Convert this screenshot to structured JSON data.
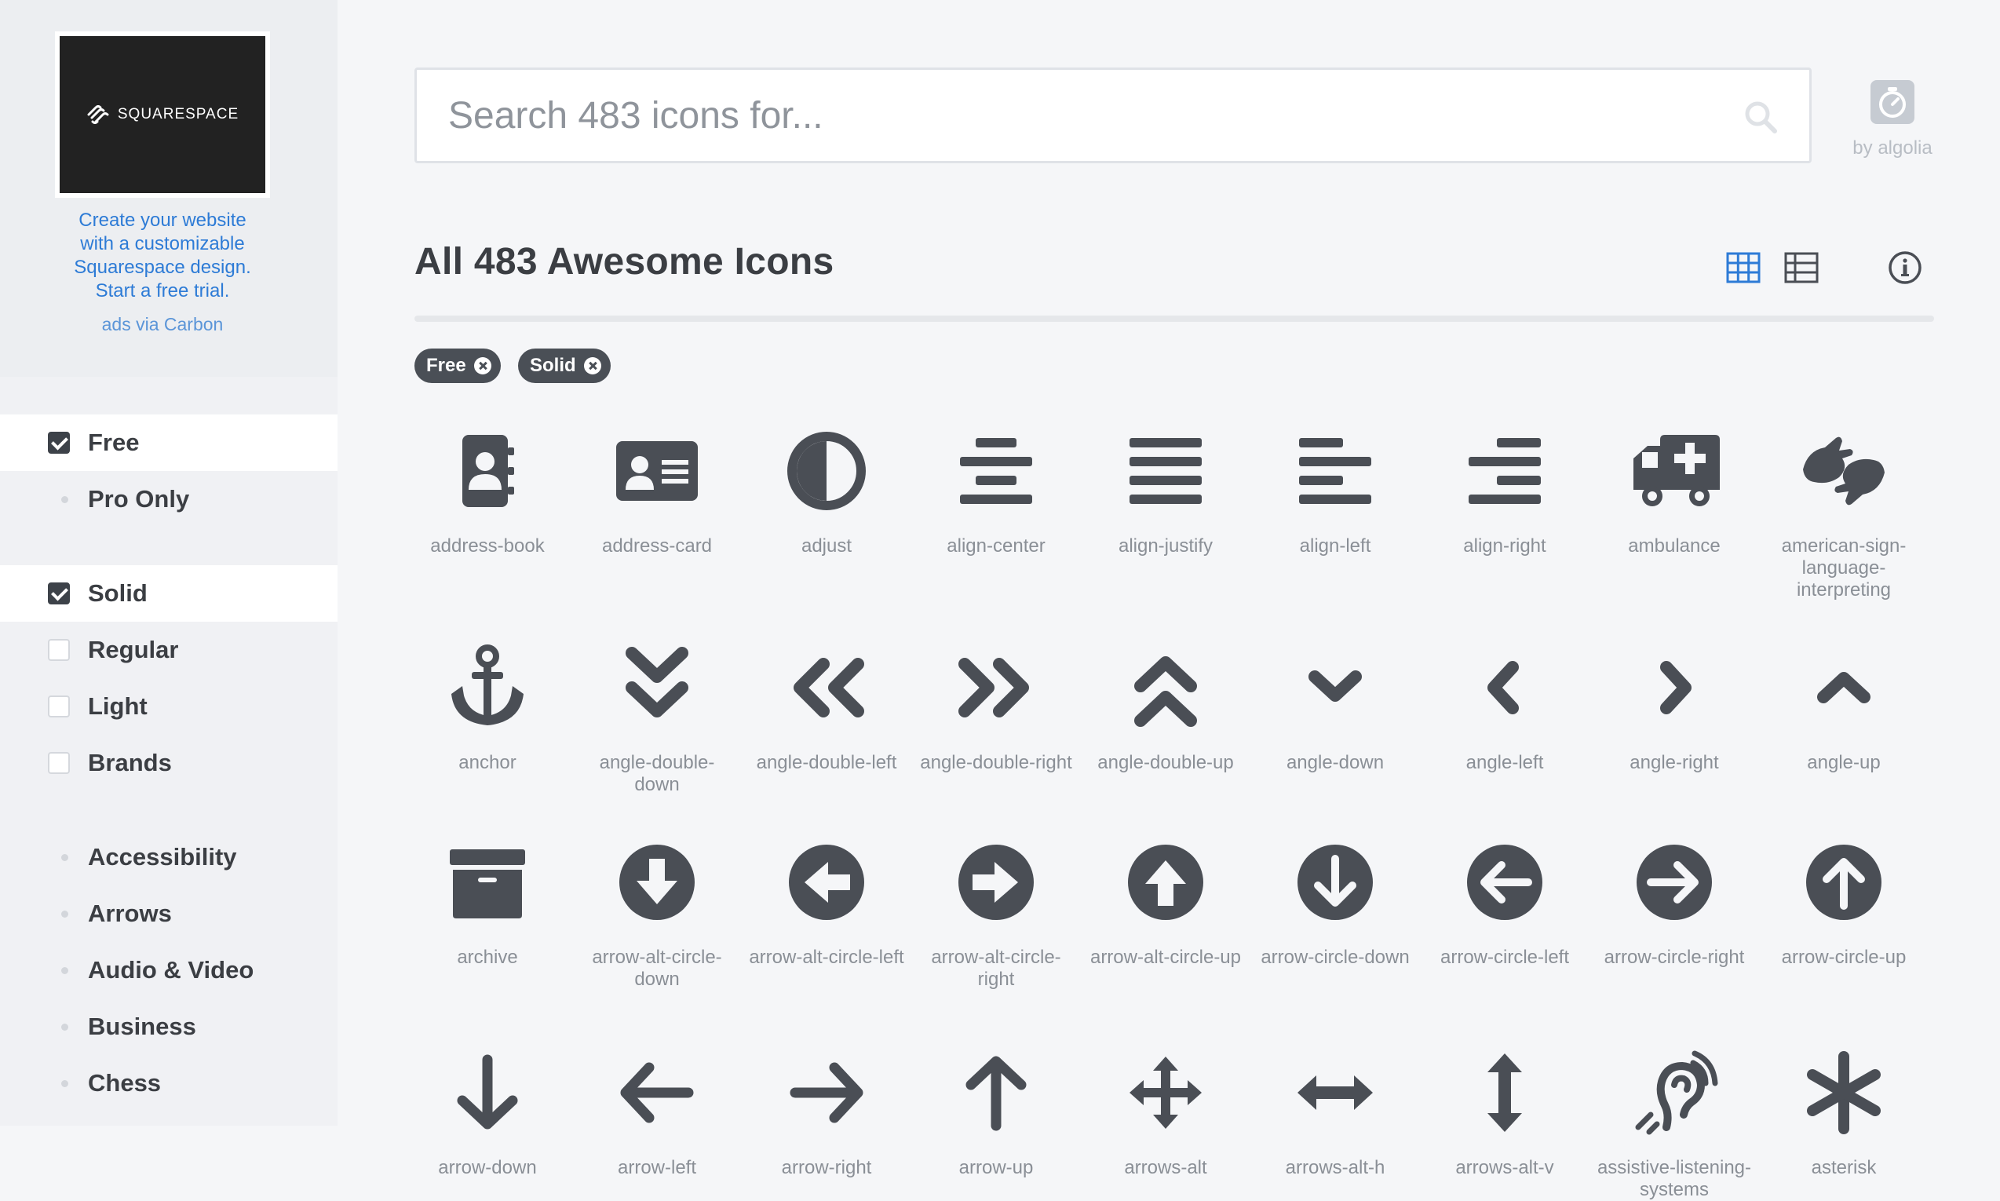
{
  "ad": {
    "brand": "SQUARESPACE",
    "line1": "Create your website",
    "line2": "with a customizable",
    "line3": "Squarespace design.",
    "line4": "Start a free trial.",
    "via": "ads via Carbon"
  },
  "filters": {
    "license": [
      {
        "label": "Free",
        "checked": true
      },
      {
        "label": "Pro Only",
        "checked": false
      }
    ],
    "styles": [
      {
        "label": "Solid",
        "checked": true
      },
      {
        "label": "Regular",
        "checked": false
      },
      {
        "label": "Light",
        "checked": false
      },
      {
        "label": "Brands",
        "checked": false
      }
    ],
    "categories": [
      "Accessibility",
      "Arrows",
      "Audio & Video",
      "Business",
      "Chess"
    ]
  },
  "search": {
    "placeholder": "Search 483 icons for...",
    "by": "by algolia"
  },
  "header": {
    "title": "All 483 Awesome Icons"
  },
  "active_tags": [
    "Free",
    "Solid"
  ],
  "icons": [
    [
      "address-book",
      "address-card",
      "adjust",
      "align-center",
      "align-justify",
      "align-left",
      "align-right",
      "ambulance",
      "american-sign-language-interpreting"
    ],
    [
      "anchor",
      "angle-double-down",
      "angle-double-left",
      "angle-double-right",
      "angle-double-up",
      "angle-down",
      "angle-left",
      "angle-right",
      "angle-up"
    ],
    [
      "archive",
      "arrow-alt-circle-down",
      "arrow-alt-circle-left",
      "arrow-alt-circle-right",
      "arrow-alt-circle-up",
      "arrow-circle-down",
      "arrow-circle-left",
      "arrow-circle-right",
      "arrow-circle-up"
    ],
    [
      "arrow-down",
      "arrow-left",
      "arrow-right",
      "arrow-up",
      "arrows-alt",
      "arrows-alt-h",
      "arrows-alt-v",
      "assistive-listening-systems",
      "asterisk"
    ]
  ],
  "colors": {
    "icon": "#4a4e55",
    "accent": "#2d7bd6",
    "label": "#8a8f96"
  }
}
